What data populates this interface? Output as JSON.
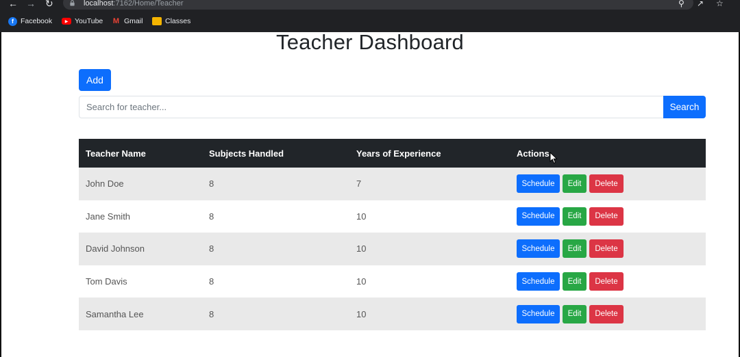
{
  "browser": {
    "url_host": "localhost",
    "url_path": ":7162/Home/Teacher",
    "bookmarks": [
      {
        "label": "Facebook",
        "icon": "facebook-icon",
        "color": "#1877f2"
      },
      {
        "label": "YouTube",
        "icon": "youtube-icon",
        "color": "#ff0000"
      },
      {
        "label": "Gmail",
        "icon": "gmail-icon",
        "color": "#ea4335"
      },
      {
        "label": "Classes",
        "icon": "classroom-icon",
        "color": "#f4b400"
      }
    ]
  },
  "page": {
    "title": "Teacher Dashboard",
    "add_label": "Add",
    "search_placeholder": "Search for teacher...",
    "search_label": "Search"
  },
  "table": {
    "headers": [
      "Teacher Name",
      "Subjects Handled",
      "Years of Experience",
      "Actions"
    ],
    "rows": [
      {
        "name": "John Doe",
        "subjects": "8",
        "years": "7"
      },
      {
        "name": "Jane Smith",
        "subjects": "8",
        "years": "10"
      },
      {
        "name": "David Johnson",
        "subjects": "8",
        "years": "10"
      },
      {
        "name": "Tom Davis",
        "subjects": "8",
        "years": "10"
      },
      {
        "name": "Samantha Lee",
        "subjects": "8",
        "years": "10"
      }
    ],
    "actions": {
      "schedule": "Schedule",
      "edit": "Edit",
      "delete": "Delete"
    }
  },
  "colors": {
    "primary": "#0d6efd",
    "success": "#28a745",
    "danger": "#dc3545",
    "header_dark": "#212529"
  }
}
